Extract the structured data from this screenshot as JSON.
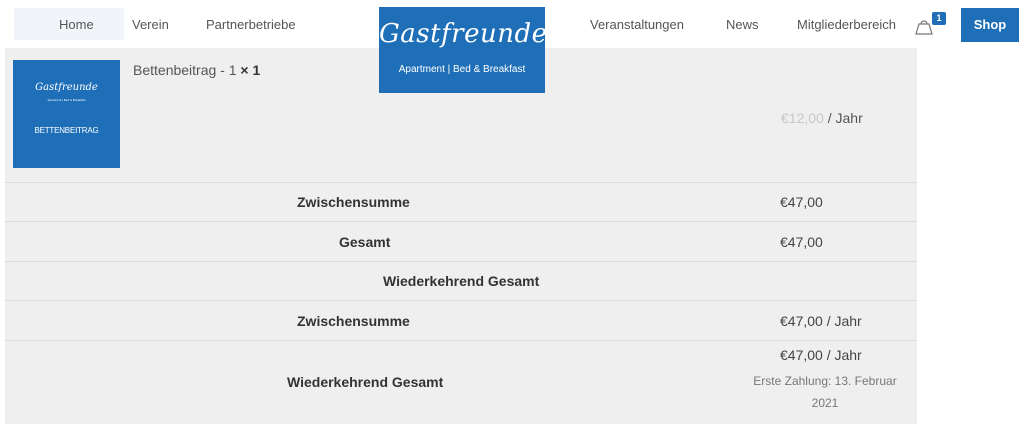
{
  "nav": {
    "home": "Home",
    "verein": "Verein",
    "partner": "Partnerbetriebe",
    "events": "Veranstaltungen",
    "news": "News",
    "members": "Mitgliederbereich",
    "cart_count": "1",
    "shop": "Shop"
  },
  "logo": {
    "script": "Gastfreunde",
    "subtitle": "Apartment | Bed & Breakfast"
  },
  "item": {
    "thumb_script": "Gastfreunde",
    "thumb_sub": "Apartment | Bed & Breakfast",
    "thumb_label": "BETTENBEITRAG",
    "name": "Bettenbeitrag - 1",
    "qty": "× 1",
    "price_old": "€12,00",
    "per": " / Jahr"
  },
  "totals": {
    "subtotal_label": "Zwischensumme",
    "subtotal_value": "€47,00",
    "total_label": "Gesamt",
    "total_value": "€47,00",
    "recurring_heading": "Wiederkehrend Gesamt",
    "rec_subtotal_label": "Zwischensumme",
    "rec_subtotal_value": "€47,00 / Jahr",
    "rec_total_label": "Wiederkehrend Gesamt",
    "rec_total_value": "€47,00 / Jahr",
    "first_payment_line1": "Erste Zahlung: 13. Februar",
    "first_payment_line2": "2021"
  },
  "colors": {
    "accent": "#1f6fb8",
    "row_bg": "#efefef"
  }
}
